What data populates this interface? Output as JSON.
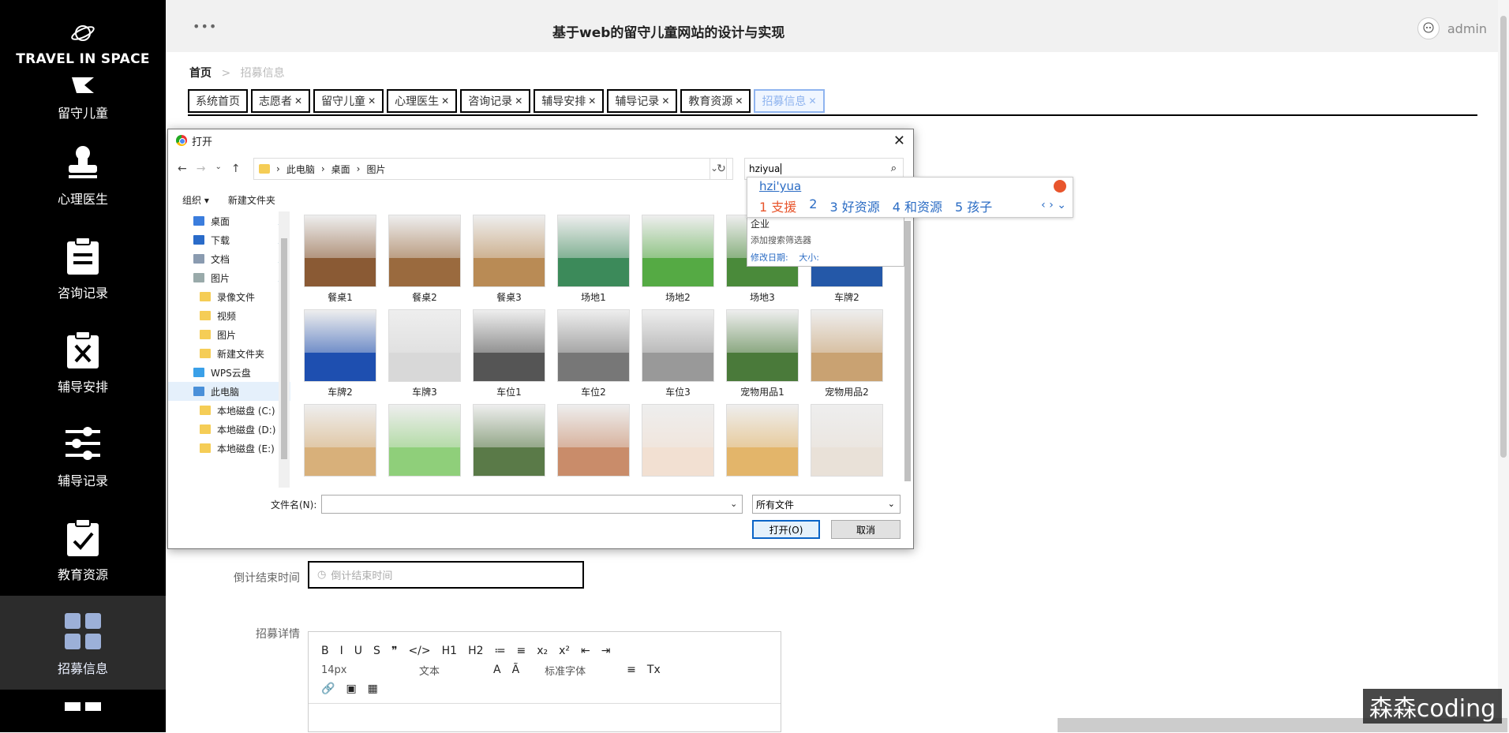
{
  "brand": {
    "name": "TRAVEL IN SPACE"
  },
  "sidebar": {
    "items": [
      {
        "label": "留守儿童",
        "icon": "flag-icon"
      },
      {
        "label": "心理医生",
        "icon": "stamp-icon"
      },
      {
        "label": "咨询记录",
        "icon": "clipboard-list-icon"
      },
      {
        "label": "辅导安排",
        "icon": "clipboard-x-icon"
      },
      {
        "label": "辅导记录",
        "icon": "sliders-icon"
      },
      {
        "label": "教育资源",
        "icon": "clipboard-check-icon"
      },
      {
        "label": "招募信息",
        "icon": "grid-icon",
        "active": true
      }
    ]
  },
  "header": {
    "title": "基于web的留守儿童网站的设计与实现",
    "user": "admin",
    "menu_icon": "•••"
  },
  "breadcrumb": {
    "home": "首页",
    "sep": ">",
    "current": "招募信息"
  },
  "tabs": [
    {
      "label": "系统首页",
      "closable": false
    },
    {
      "label": "志愿者",
      "closable": true
    },
    {
      "label": "留守儿童",
      "closable": true
    },
    {
      "label": "心理医生",
      "closable": true
    },
    {
      "label": "咨询记录",
      "closable": true
    },
    {
      "label": "辅导安排",
      "closable": true
    },
    {
      "label": "辅导记录",
      "closable": true
    },
    {
      "label": "教育资源",
      "closable": true
    },
    {
      "label": "招募信息",
      "closable": true,
      "active": true
    }
  ],
  "form": {
    "end_time_label": "倒计结束时间",
    "end_time_placeholder": "倒计结束时间",
    "details_label": "招募详情",
    "editor": {
      "row1": [
        "B",
        "I",
        "U",
        "S",
        "❞",
        "</>",
        "H1",
        "H2",
        "≔",
        "≡",
        "x₂",
        "x²",
        "⇤",
        "⇥"
      ],
      "font_size": "14px",
      "text_style": "文本",
      "font_family": "标准字体",
      "row3": [
        "🔗",
        "▣",
        "▦"
      ]
    }
  },
  "dialog": {
    "title": "打开",
    "path": [
      "此电脑",
      "桌面",
      "图片"
    ],
    "search_value": "hziyua",
    "toolbar": {
      "organize": "组织 ▾",
      "new_folder": "新建文件夹"
    },
    "tree": [
      {
        "label": "桌面",
        "pin": true
      },
      {
        "label": "下载",
        "pin": true
      },
      {
        "label": "文档",
        "pin": true
      },
      {
        "label": "图片",
        "pin": true
      },
      {
        "label": "录像文件",
        "sub": true
      },
      {
        "label": "视频",
        "sub": true
      },
      {
        "label": "图片",
        "sub": true
      },
      {
        "label": "新建文件夹",
        "sub": true
      },
      {
        "label": "WPS云盘"
      },
      {
        "label": "此电脑",
        "selected": true
      },
      {
        "label": "本地磁盘 (C:)",
        "sub": true
      },
      {
        "label": "本地磁盘 (D:)",
        "sub": true
      },
      {
        "label": "本地磁盘 (E:)",
        "sub": true
      }
    ],
    "files": [
      {
        "name": "餐桌1",
        "color": "#8a5a34"
      },
      {
        "name": "餐桌2",
        "color": "#9a6a3e"
      },
      {
        "name": "餐桌3",
        "color": "#b98b55"
      },
      {
        "name": "场地1",
        "color": "#3c8a5a"
      },
      {
        "name": "场地2",
        "color": "#55aa44"
      },
      {
        "name": "场地3",
        "color": "#4a8a3a"
      },
      {
        "name": "车牌2",
        "color": "#2458a8"
      },
      {
        "name": "车牌2",
        "color": "#1e4fb0"
      },
      {
        "name": "车牌3",
        "color": "#d8d8d8"
      },
      {
        "name": "车位1",
        "color": "#555"
      },
      {
        "name": "车位2",
        "color": "#777"
      },
      {
        "name": "车位3",
        "color": "#999"
      },
      {
        "name": "宠物用品1",
        "color": "#4a7a3a"
      },
      {
        "name": "宠物用品2",
        "color": "#c9a272"
      },
      {
        "name": "",
        "color": "#d8b07a"
      },
      {
        "name": "",
        "color": "#8fcf7a"
      },
      {
        "name": "",
        "color": "#5a7a48"
      },
      {
        "name": "",
        "color": "#c98c6a"
      },
      {
        "name": "",
        "color": "#f2e0d2"
      },
      {
        "name": "",
        "color": "#e3b56a"
      },
      {
        "name": "",
        "color": "#e9e1d8"
      }
    ],
    "filename_label": "文件名(N):",
    "filetype": "所有文件",
    "open_btn": "打开(O)",
    "cancel_btn": "取消",
    "suggest": {
      "a": "企业",
      "b": "添加搜索筛选器",
      "c1": "修改日期:",
      "c2": "大小:"
    }
  },
  "ime": {
    "pinyin": "hzi'yua",
    "candidates": [
      "1 支援",
      "2",
      "3 好资源",
      "4 和资源",
      "5 孩子"
    ]
  },
  "watermark": "森森coding"
}
